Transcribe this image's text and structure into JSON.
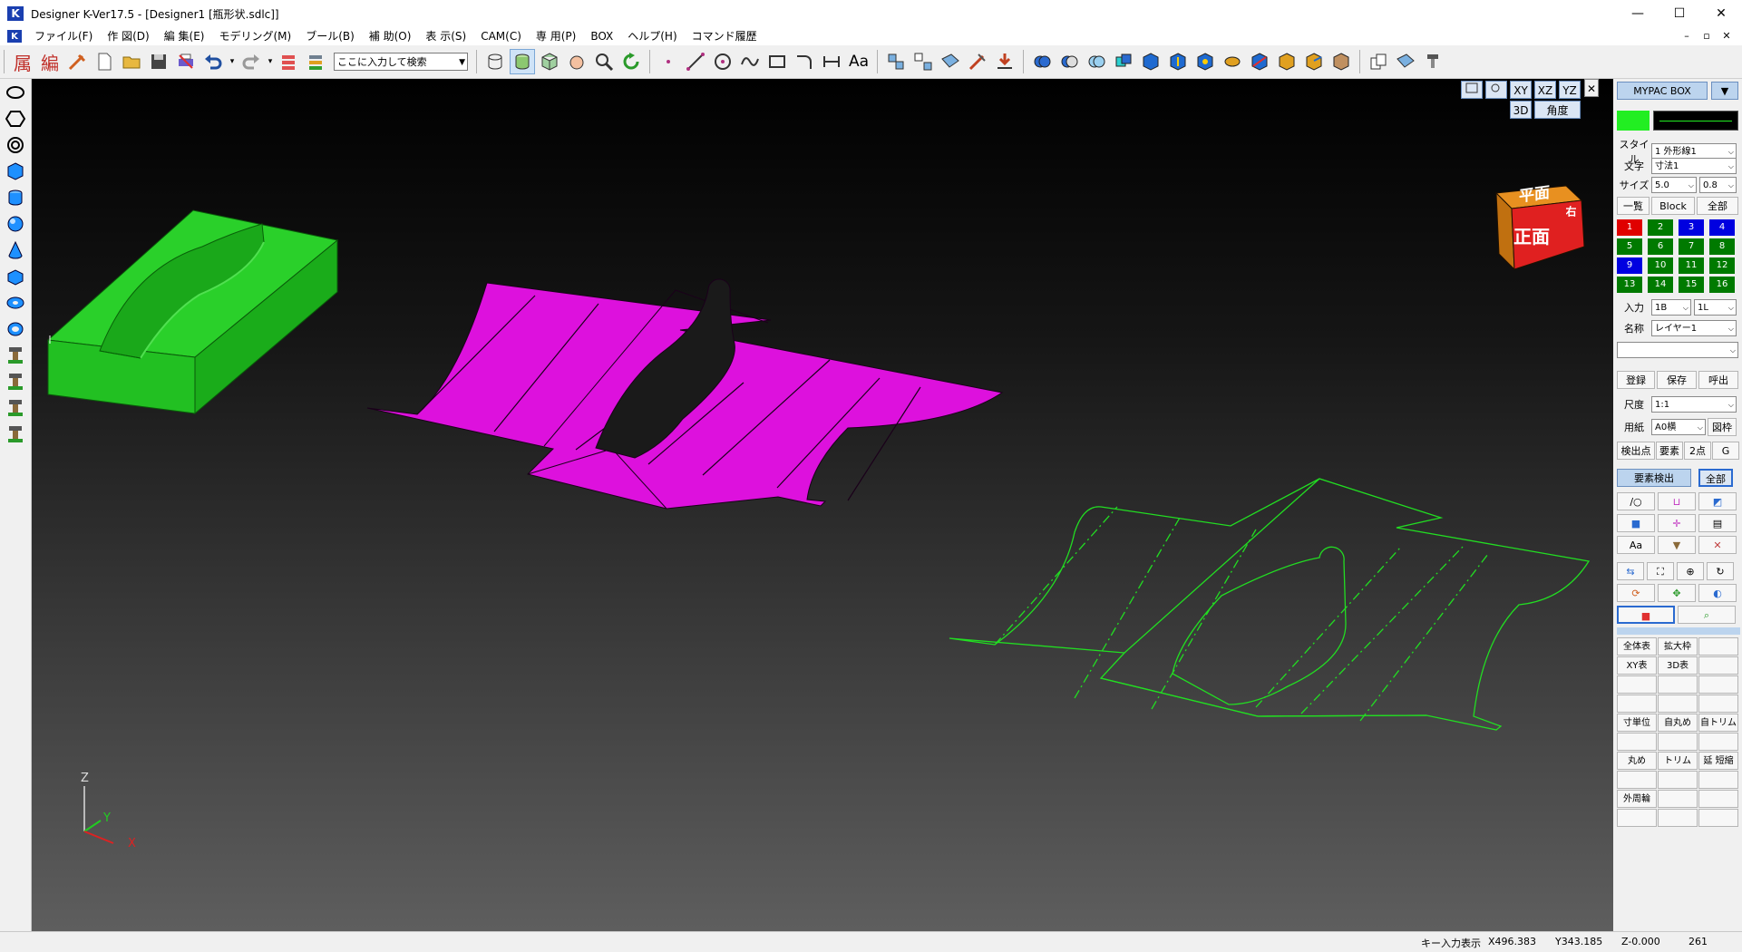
{
  "window": {
    "title": "Designer K-Ver17.5 - [Designer1 [瓶形状.sdlc]]",
    "logo": "K",
    "minimize": "—",
    "maximize": "☐",
    "close": "✕"
  },
  "menu": [
    "ファイル(F)",
    "作 図(D)",
    "編 集(E)",
    "モデリング(M)",
    "ブール(B)",
    "補 助(O)",
    "表 示(S)",
    "CAM(C)",
    "専 用(P)",
    "BOX",
    "ヘルプ(H)",
    "コマンド履歴"
  ],
  "mdi_controls": [
    "–",
    "▫",
    "✕"
  ],
  "toolbar": {
    "attr_label": "属",
    "edit_label": "編",
    "search_placeholder": "ここに入力して検索",
    "text_tool_label": "Aa"
  },
  "left_tools": [
    "ellipse-icon",
    "hexagon-icon",
    "spiral-icon",
    "box-icon",
    "cylinder-icon",
    "sphere-icon",
    "cone-icon",
    "prism-icon",
    "torus-icon",
    "pipe-icon",
    "tool-1-icon",
    "tool-2-icon",
    "tool-3-icon",
    "tool-4-icon"
  ],
  "viewport": {
    "view_buttons": [
      "XY",
      "XZ",
      "YZ",
      "3D",
      "角度"
    ],
    "close": "✕",
    "cube_top": "平面",
    "cube_front": "正面",
    "cube_side": "右側",
    "axis_z": "Z",
    "axis_y": "Y",
    "axis_x": "X",
    "colors": {
      "solid": "#22cc22",
      "surface": "#dd11dd",
      "wire": "#22dd22",
      "cube_front": "#e02020",
      "cube_top": "#e89020"
    }
  },
  "panel": {
    "mypac": "MYPAC BOX",
    "style_label": "スタイル",
    "style_value": "1 外形線1",
    "text_label": "文字",
    "text_value": "寸法1",
    "size_label": "サイズ",
    "size_value": "5.0",
    "size_value2": "0.8",
    "tabs": [
      "一覧",
      "Block",
      "全部"
    ],
    "layers": [
      {
        "n": "1",
        "c": "#e00000"
      },
      {
        "n": "2",
        "c": "#007a00"
      },
      {
        "n": "3",
        "c": "#0000e0"
      },
      {
        "n": "4",
        "c": "#0000e0"
      },
      {
        "n": "5",
        "c": "#007a00"
      },
      {
        "n": "6",
        "c": "#007a00"
      },
      {
        "n": "7",
        "c": "#007a00"
      },
      {
        "n": "8",
        "c": "#007a00"
      },
      {
        "n": "9",
        "c": "#0000e0"
      },
      {
        "n": "10",
        "c": "#007a00"
      },
      {
        "n": "11",
        "c": "#007a00"
      },
      {
        "n": "12",
        "c": "#007a00"
      },
      {
        "n": "13",
        "c": "#007a00"
      },
      {
        "n": "14",
        "c": "#007a00"
      },
      {
        "n": "15",
        "c": "#007a00"
      },
      {
        "n": "16",
        "c": "#007a00"
      }
    ],
    "input_label": "入力",
    "input_value": "1B",
    "input_value2": "1L",
    "name_label": "名称",
    "name_value": "レイヤー1",
    "register": "登録",
    "save": "保存",
    "recall": "呼出",
    "scale_label": "尺度",
    "scale_value": "1:1",
    "paper_label": "用紙",
    "paper_value": "A0横",
    "frame": "図枠",
    "snap_buttons": [
      "検出点",
      "要素",
      "2点",
      "G"
    ],
    "element_detect": "要素検出",
    "all": "全部",
    "text_aa": "Aa",
    "grid_buttons": [
      "全体表",
      "拡大枠",
      "XY表",
      "3D表",
      "寸単位",
      "自丸め",
      "自トリム",
      "丸め",
      "トリム",
      "延 短縮",
      "外周輪"
    ]
  },
  "status": {
    "key_input": "キー入力表示",
    "x": "X496.383",
    "y": "Y343.185",
    "z": "Z-0.000",
    "count": "261"
  }
}
